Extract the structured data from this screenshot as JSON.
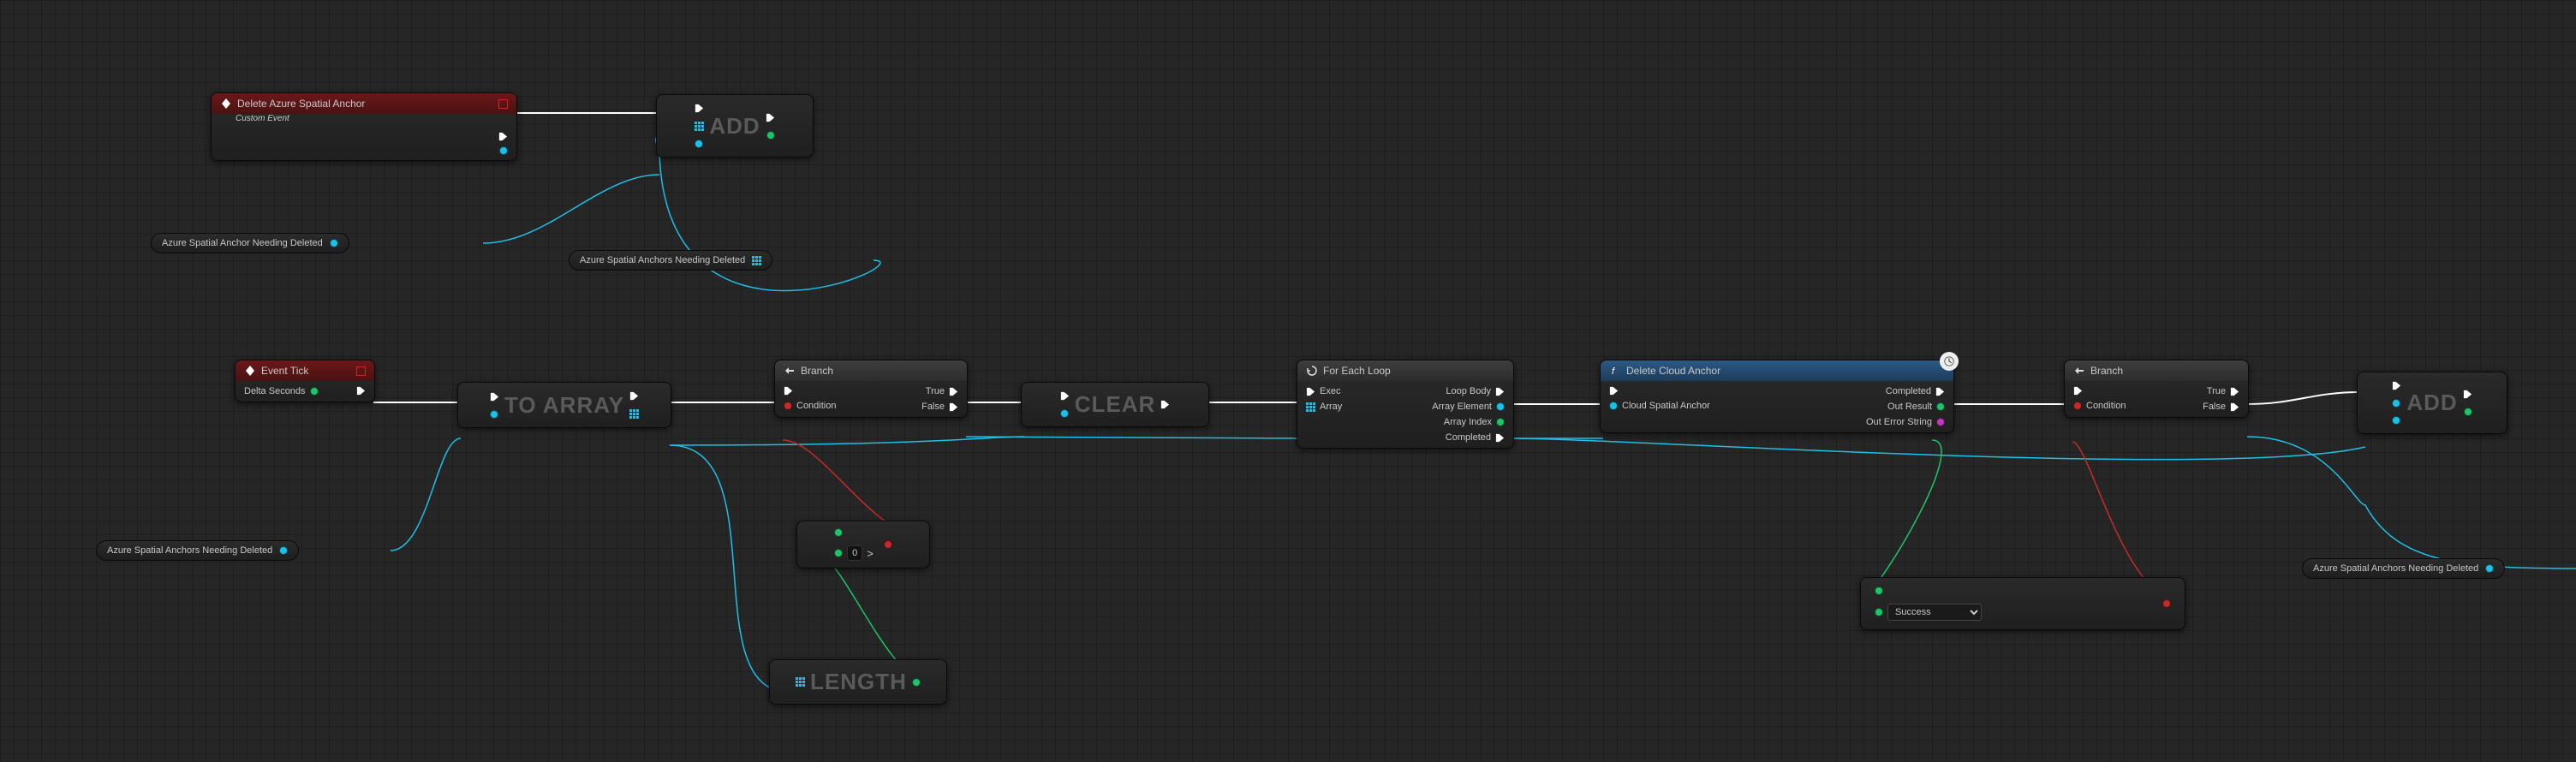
{
  "nodes": {
    "customEvent": {
      "title": "Delete Azure Spatial Anchor",
      "subtitle": "Custom Event"
    },
    "add1": {
      "label": "ADD"
    },
    "eventTick": {
      "title": "Event Tick",
      "deltaSeconds": "Delta Seconds"
    },
    "toArray": {
      "label": "TO ARRAY"
    },
    "branch1": {
      "title": "Branch",
      "condition": "Condition",
      "true": "True",
      "false": "False"
    },
    "clear": {
      "label": "CLEAR"
    },
    "length": {
      "label": "LENGTH"
    },
    "greaterThan": {
      "value": "0"
    },
    "forEach": {
      "title": "For Each Loop",
      "exec": "Exec",
      "array": "Array",
      "loopBody": "Loop Body",
      "arrayElement": "Array Element",
      "arrayIndex": "Array Index",
      "completed": "Completed"
    },
    "deleteCloud": {
      "title": "Delete Cloud Anchor",
      "cloudSpatialAnchor": "Cloud Spatial Anchor",
      "completed": "Completed",
      "outResult": "Out Result",
      "outError": "Out Error String"
    },
    "branch2": {
      "title": "Branch",
      "condition": "Condition",
      "true": "True",
      "false": "False"
    },
    "equals": {
      "value": "Success"
    },
    "add2": {
      "label": "ADD"
    }
  },
  "vars": {
    "anchorNeedingDeleted": "Azure Spatial Anchor Needing Deleted",
    "anchorsNeedingDeleted": "Azure Spatial Anchors Needing Deleted"
  }
}
